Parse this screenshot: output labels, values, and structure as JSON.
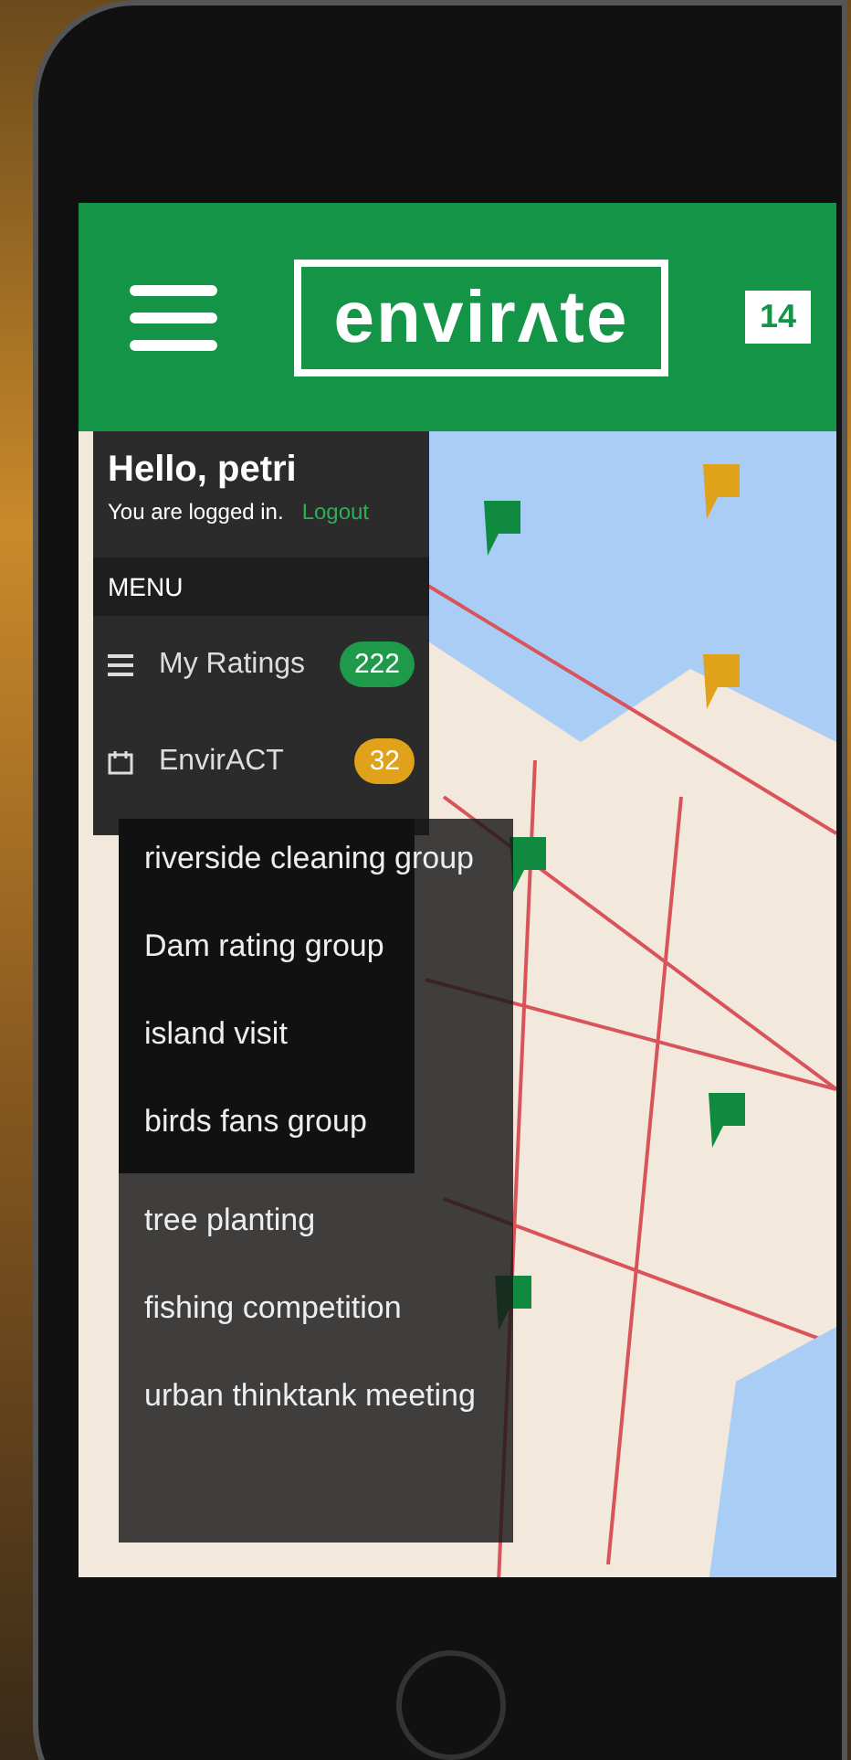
{
  "header": {
    "logo": "envirʌte",
    "notifications": "14"
  },
  "sidebar": {
    "greeting": "Hello, petri",
    "status": "You are logged in.",
    "logout": "Logout",
    "section": "MENU",
    "items": [
      {
        "label": "My Ratings",
        "badge": "222",
        "color": "#1e9a4a",
        "kind": "list"
      },
      {
        "label": "EnvirACT",
        "badge": "32",
        "color": "#e0a21a",
        "kind": "calendar"
      }
    ]
  },
  "dropdown": {
    "items": [
      {
        "label": "riverside cleaning group",
        "kind": "boxed"
      },
      {
        "label": "Dam rating group",
        "kind": "boxed"
      },
      {
        "label": "island visit",
        "kind": "boxed"
      },
      {
        "label": "birds fans group",
        "kind": "boxed"
      },
      {
        "label": "tree planting",
        "kind": "plain"
      },
      {
        "label": "fishing competition",
        "kind": "plain"
      },
      {
        "label": "urban thinktank meeting",
        "kind": "plain"
      }
    ]
  }
}
